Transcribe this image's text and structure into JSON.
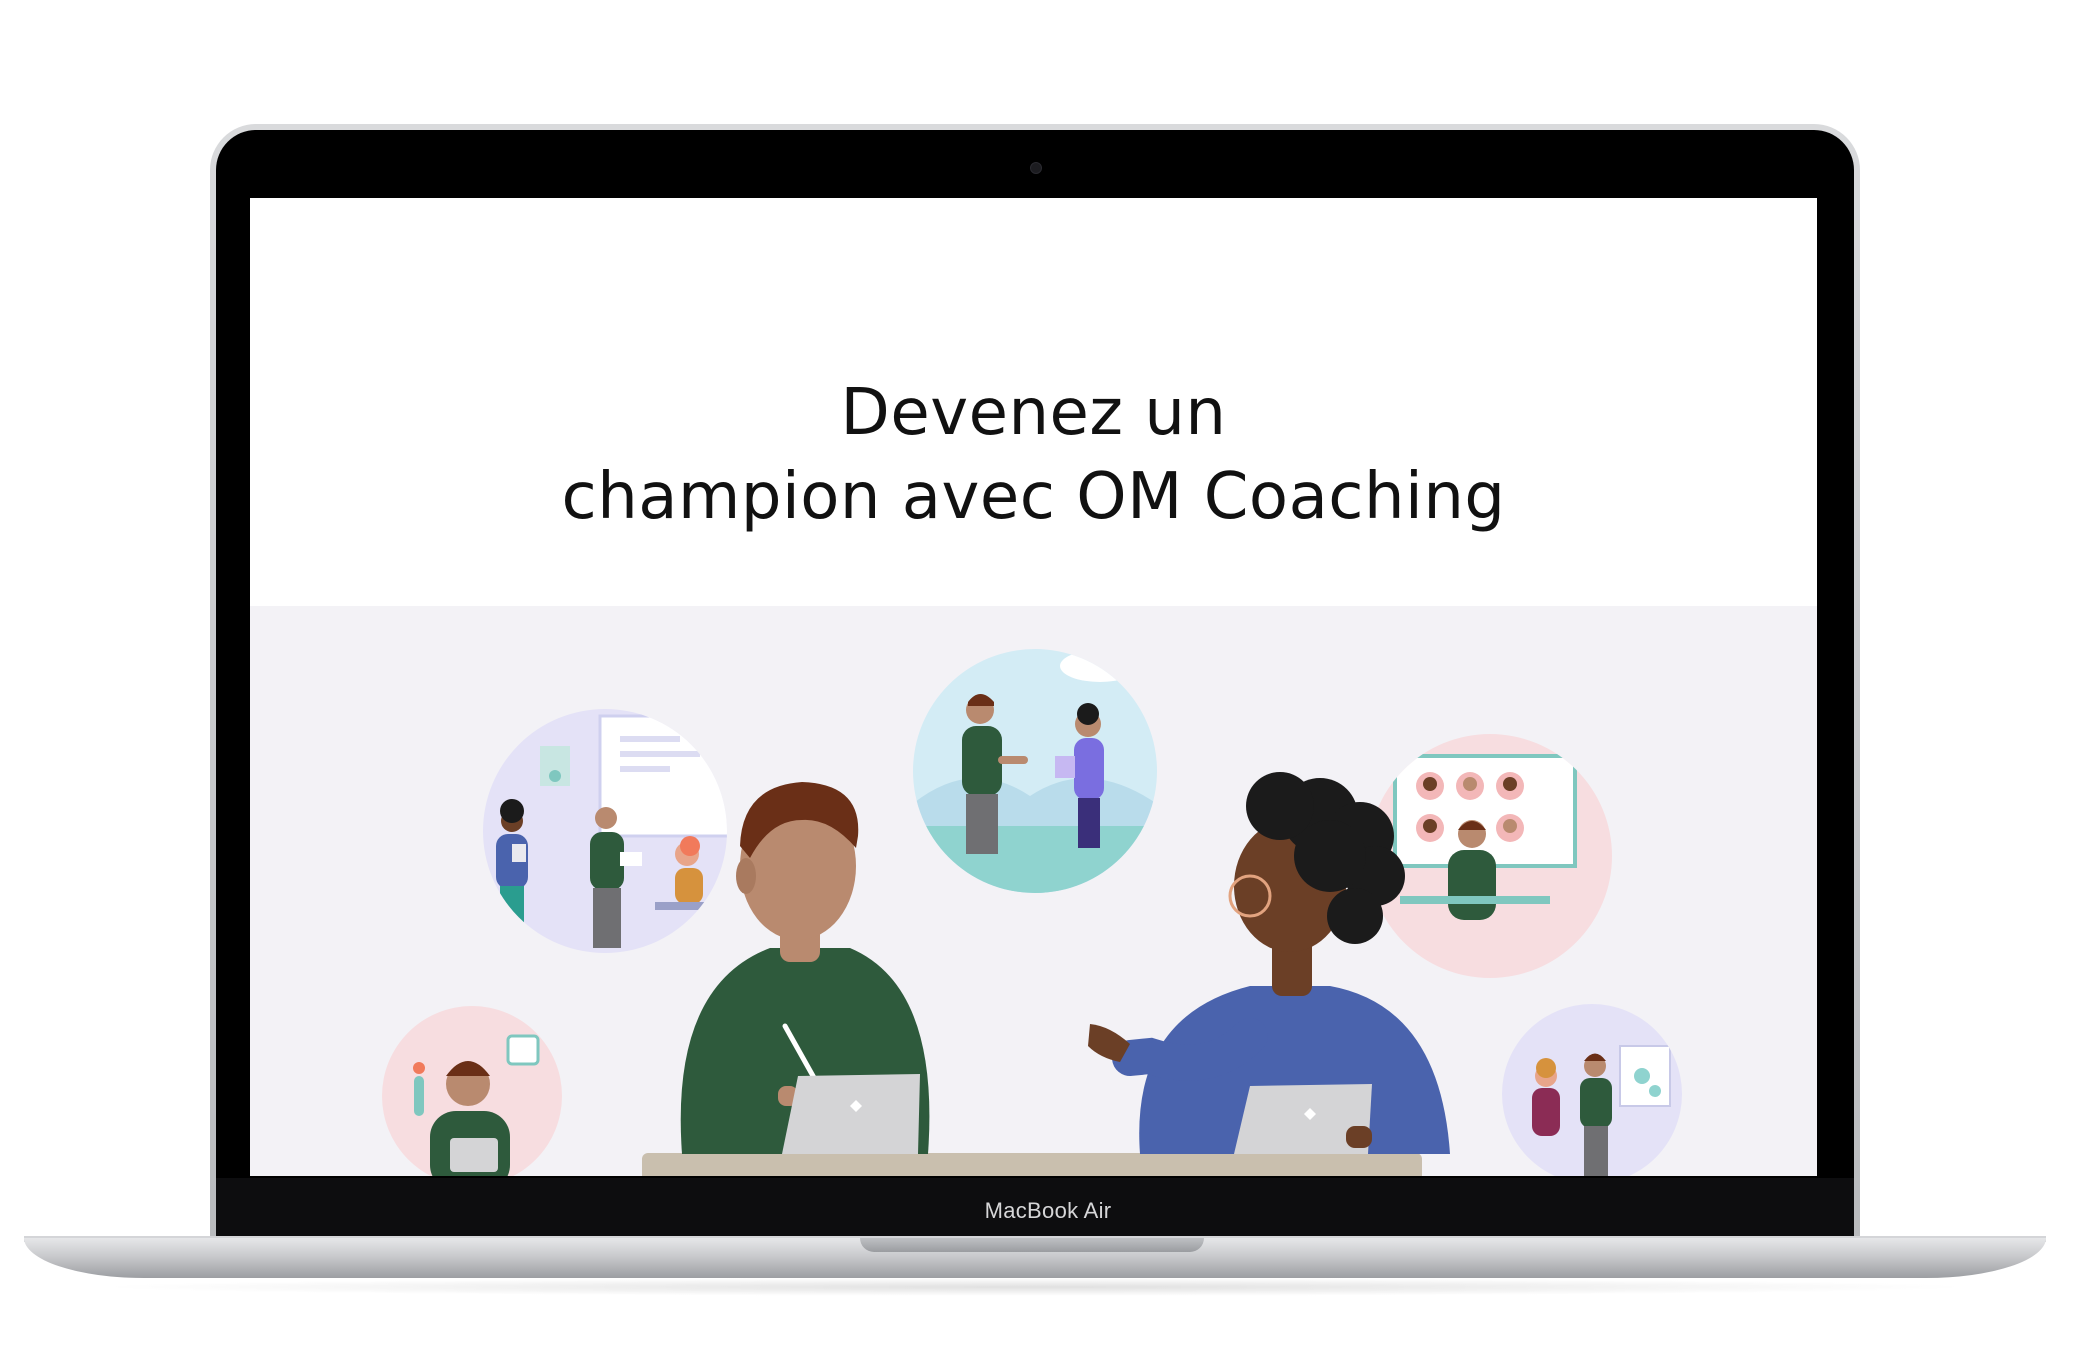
{
  "page": {
    "headline_line1": "Devenez un",
    "headline_line2": "champion avec OM Coaching"
  },
  "device": {
    "label": "MacBook Air"
  },
  "illustration": {
    "background_color": "#f3f2f6",
    "skin_light": "#b98a6f",
    "skin_dark": "#6b3f26",
    "shirt_green": "#2e5a3c",
    "shirt_blue": "#4a63ad",
    "hair_brown": "#6a2f17",
    "hair_black": "#1b1b1b",
    "table": "#c9bfae",
    "tablet": "#d4d4d6"
  },
  "colors": {
    "screen_bg": "#ffffff",
    "headline_text": "#111111",
    "bezel": "#000000",
    "chassis": "#c8c9cc"
  }
}
